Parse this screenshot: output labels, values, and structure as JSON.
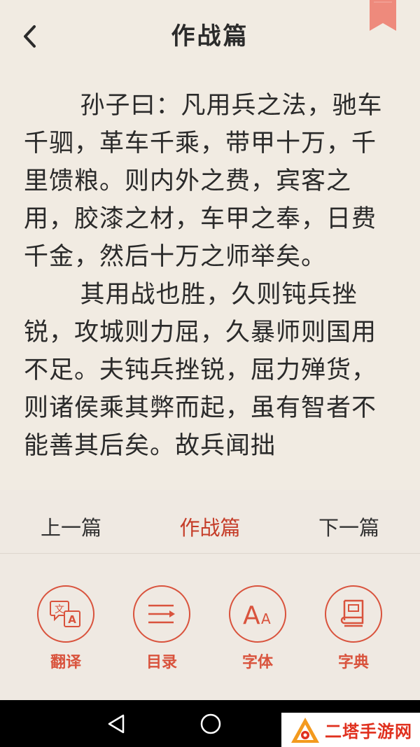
{
  "header": {
    "title": "作战篇",
    "back_icon": "chevron-left-icon",
    "bookmark_icon": "bookmark-ribbon-icon"
  },
  "content": {
    "paragraphs": [
      "孙子曰：凡用兵之法，驰车千驷，革车千乘，带甲十万，千里馈粮。则内外之费，宾客之用，胶漆之材，车甲之奉，日费千金，然后十万之师举矣。",
      "其用战也胜，久则钝兵挫锐，攻城则力屈，久暴师则国用不足。夫钝兵挫锐，屈力殚货，则诸侯乘其弊而起，虽有智者不能善其后矣。故兵闻拙"
    ]
  },
  "chapter_nav": {
    "prev_label": "上一篇",
    "current_label": "作战篇",
    "next_label": "下一篇"
  },
  "tools": [
    {
      "label": "翻译",
      "icon": "translate-icon"
    },
    {
      "label": "目录",
      "icon": "table-of-contents-icon"
    },
    {
      "label": "字体",
      "icon": "font-size-icon"
    },
    {
      "label": "字典",
      "icon": "dictionary-icon"
    }
  ],
  "system_nav": {
    "back_icon": "triangle-back-icon",
    "home_icon": "circle-home-icon"
  },
  "watermark": {
    "text": "二塔手游网"
  },
  "colors": {
    "accent": "#d9533d",
    "active_chapter": "#c53d29",
    "background": "#f1ebe2",
    "bookmark": "#ee8a7c"
  }
}
